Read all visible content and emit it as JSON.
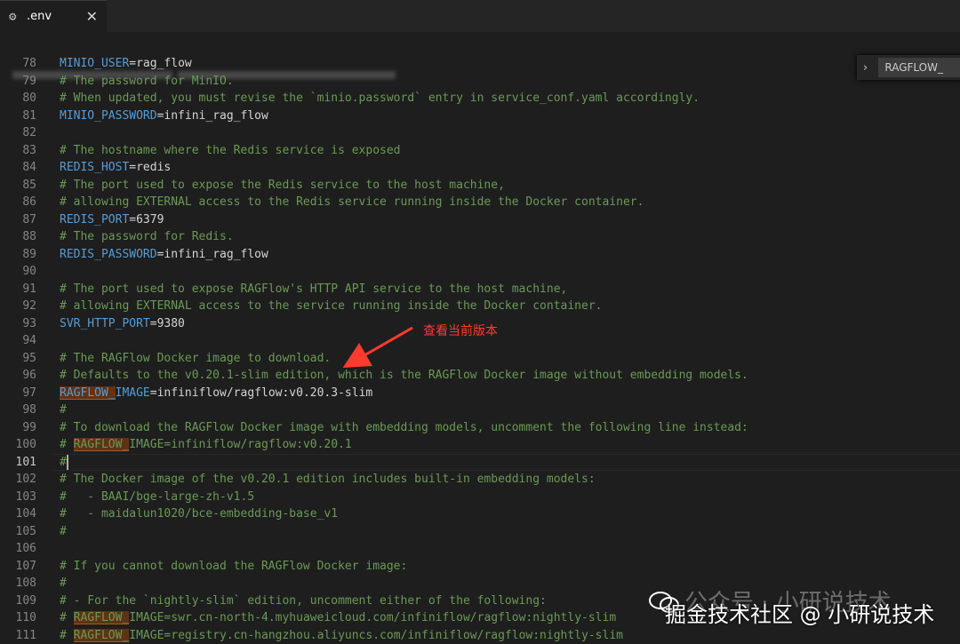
{
  "tab": {
    "name": ".env",
    "gear_icon": "gear-icon",
    "close_icon": "close-icon"
  },
  "find_widget": {
    "value": "RAGFLOW_",
    "toggle_icon": "chevron-right-icon"
  },
  "annotation": {
    "text": "查看当前版本",
    "color": "#ff3b30"
  },
  "watermark": {
    "line1": "公众号 · 小研说技术",
    "line2": "掘金技术社区 @ 小研说技术"
  },
  "colors": {
    "comment": "#6a9955",
    "key": "#569cd6",
    "text": "#d4d4d4",
    "match": "#613214"
  },
  "lines": [
    {
      "n": "78",
      "t": "kv",
      "k": "MINIO_USER",
      "v": "rag_flow"
    },
    {
      "n": "79",
      "t": "c",
      "text": "# The password for MinIO."
    },
    {
      "n": "80",
      "t": "c",
      "text": "# When updated, you must revise the `minio.password` entry in service_conf.yaml accordingly."
    },
    {
      "n": "81",
      "t": "kv",
      "k": "MINIO_PASSWORD",
      "v": "infini_rag_flow"
    },
    {
      "n": "82",
      "t": "e"
    },
    {
      "n": "83",
      "t": "c",
      "text": "# The hostname where the Redis service is exposed"
    },
    {
      "n": "84",
      "t": "kv",
      "k": "REDIS_HOST",
      "v": "redis"
    },
    {
      "n": "85",
      "t": "c",
      "text": "# The port used to expose the Redis service to the host machine,"
    },
    {
      "n": "86",
      "t": "c",
      "text": "# allowing EXTERNAL access to the Redis service running inside the Docker container."
    },
    {
      "n": "87",
      "t": "kv",
      "k": "REDIS_PORT",
      "v": "6379"
    },
    {
      "n": "88",
      "t": "c",
      "text": "# The password for Redis."
    },
    {
      "n": "89",
      "t": "kv",
      "k": "REDIS_PASSWORD",
      "v": "infini_rag_flow"
    },
    {
      "n": "90",
      "t": "e"
    },
    {
      "n": "91",
      "t": "c",
      "text": "# The port used to expose RAGFlow's HTTP API service to the host machine,"
    },
    {
      "n": "92",
      "t": "c",
      "text": "# allowing EXTERNAL access to the service running inside the Docker container."
    },
    {
      "n": "93",
      "t": "kv",
      "k": "SVR_HTTP_PORT",
      "v": "9380"
    },
    {
      "n": "94",
      "t": "e"
    },
    {
      "n": "95",
      "t": "c",
      "text": "# The RAGFlow Docker image to download."
    },
    {
      "n": "96",
      "t": "c",
      "text": "# Defaults to the v0.20.1-slim edition, which is the RAGFlow Docker image without embedding models."
    },
    {
      "n": "97",
      "t": "kvh",
      "m": "RAGFLOW_",
      "k": "IMAGE",
      "v": "infiniflow/ragflow:v0.20.3-slim"
    },
    {
      "n": "98",
      "t": "c",
      "text": "#"
    },
    {
      "n": "99",
      "t": "c",
      "text": "# To download the RAGFlow Docker image with embedding models, uncomment the following line instead:"
    },
    {
      "n": "100",
      "t": "ch",
      "pre": "# ",
      "m": "RAGFLOW_",
      "post": "IMAGE=infiniflow/ragflow:v0.20.1"
    },
    {
      "n": "101",
      "t": "cur",
      "text": "#"
    },
    {
      "n": "102",
      "t": "c",
      "text": "# The Docker image of the v0.20.1 edition includes built-in embedding models:"
    },
    {
      "n": "103",
      "t": "c",
      "text": "#   - BAAI/bge-large-zh-v1.5"
    },
    {
      "n": "104",
      "t": "c",
      "text": "#   - maidalun1020/bce-embedding-base_v1"
    },
    {
      "n": "105",
      "t": "c",
      "text": "#"
    },
    {
      "n": "106",
      "t": "e"
    },
    {
      "n": "107",
      "t": "c",
      "text": "# If you cannot download the RAGFlow Docker image:"
    },
    {
      "n": "108",
      "t": "c",
      "text": "#"
    },
    {
      "n": "109",
      "t": "c",
      "text": "# - For the `nightly-slim` edition, uncomment either of the following:"
    },
    {
      "n": "110",
      "t": "ch",
      "pre": "# ",
      "m": "RAGFLOW_",
      "post": "IMAGE=swr.cn-north-4.myhuaweicloud.com/infiniflow/ragflow:nightly-slim"
    },
    {
      "n": "111",
      "t": "ch",
      "pre": "# ",
      "m": "RAGFLOW_",
      "post": "IMAGE=registry.cn-hangzhou.aliyuncs.com/infiniflow/ragflow:nightly-slim"
    }
  ]
}
